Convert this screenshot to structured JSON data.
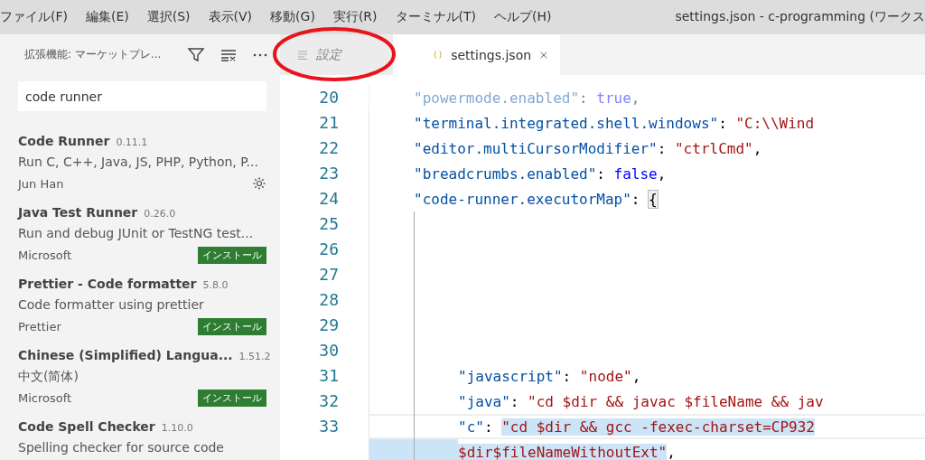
{
  "menu_bar": {
    "items": [
      "ファイル(F)",
      "編集(E)",
      "選択(S)",
      "表示(V)",
      "移動(G)",
      "実行(R)",
      "ターミナル(T)",
      "ヘルプ(H)"
    ],
    "title": "settings.json - c-programming (ワークス"
  },
  "sidebar": {
    "title": "拡張機能: マーケットプレ...",
    "search": {
      "value": "code runner"
    },
    "extensions": [
      {
        "name": "Code Runner",
        "version": "0.11.1",
        "description": "Run C, C++, Java, JS, PHP, Python, P...",
        "publisher": "Jun Han",
        "action": {
          "kind": "gear"
        }
      },
      {
        "name": "Java Test Runner",
        "version": "0.26.0",
        "description": "Run and debug JUnit or TestNG test...",
        "publisher": "Microsoft",
        "action": {
          "kind": "install",
          "label": "インストール"
        }
      },
      {
        "name": "Prettier - Code formatter",
        "version": "5.8.0",
        "description": "Code formatter using prettier",
        "publisher": "Prettier",
        "action": {
          "kind": "install",
          "label": "インストール"
        }
      },
      {
        "name": "Chinese (Simplified) Langua...",
        "version": "1.51.2",
        "description": "中文(简体)",
        "publisher": "Microsoft",
        "action": {
          "kind": "install",
          "label": "インストール"
        }
      },
      {
        "name": "Code Spell Checker",
        "version": "1.10.0",
        "description": "Spelling checker for source code"
      }
    ]
  },
  "tabs": [
    {
      "label": "設定",
      "kind": "settings",
      "selected": false
    },
    {
      "label": "settings.json",
      "kind": "json",
      "selected": true
    }
  ],
  "editor": {
    "lines": [
      {
        "number": "20",
        "faded": true,
        "nested": false,
        "current": false,
        "tokens": [
          {
            "text": "\"powermode.enabled\"",
            "kind": "key",
            "selected": false
          },
          {
            "text": ": ",
            "kind": "punct",
            "selected": false
          },
          {
            "text": "true",
            "kind": "bool",
            "selected": false
          },
          {
            "text": ",",
            "kind": "punct",
            "selected": false
          }
        ]
      },
      {
        "number": "21",
        "faded": false,
        "nested": false,
        "current": false,
        "tokens": [
          {
            "text": "\"terminal.integrated.shell.windows\"",
            "kind": "key",
            "selected": false
          },
          {
            "text": ": ",
            "kind": "punct",
            "selected": false
          },
          {
            "text": "\"C:\\\\Wind",
            "kind": "string",
            "selected": false
          }
        ]
      },
      {
        "number": "22",
        "faded": false,
        "nested": false,
        "current": false,
        "tokens": [
          {
            "text": "\"editor.multiCursorModifier\"",
            "kind": "key",
            "selected": false
          },
          {
            "text": ": ",
            "kind": "punct",
            "selected": false
          },
          {
            "text": "\"ctrlCmd\"",
            "kind": "string",
            "selected": false
          },
          {
            "text": ",",
            "kind": "punct",
            "selected": false
          }
        ]
      },
      {
        "number": "23",
        "faded": false,
        "nested": false,
        "current": false,
        "tokens": [
          {
            "text": "\"breadcrumbs.enabled\"",
            "kind": "key",
            "selected": false
          },
          {
            "text": ": ",
            "kind": "punct",
            "selected": false
          },
          {
            "text": "false",
            "kind": "bool",
            "selected": false
          },
          {
            "text": ",",
            "kind": "punct",
            "selected": false
          }
        ]
      },
      {
        "number": "24",
        "faded": false,
        "nested": false,
        "current": false,
        "tokens": [
          {
            "text": "\"code-runner.executorMap\"",
            "kind": "key",
            "selected": false
          },
          {
            "text": ": ",
            "kind": "punct",
            "selected": false
          },
          {
            "text": "{",
            "kind": "bracket",
            "selected": false
          }
        ]
      },
      {
        "number": "25",
        "faded": false,
        "nested": true,
        "current": false
      },
      {
        "number": "26",
        "faded": false,
        "nested": true,
        "current": false
      },
      {
        "number": "27",
        "faded": false,
        "nested": true,
        "current": false
      },
      {
        "number": "28",
        "faded": false,
        "nested": true,
        "current": false
      },
      {
        "number": "29",
        "faded": false,
        "nested": true,
        "current": false
      },
      {
        "number": "30",
        "faded": false,
        "nested": true,
        "current": false
      },
      {
        "number": "31",
        "faded": false,
        "nested": true,
        "current": false,
        "tokens": [
          {
            "text": "\"javascript\"",
            "kind": "key",
            "selected": false
          },
          {
            "text": ": ",
            "kind": "punct",
            "selected": false
          },
          {
            "text": "\"node\"",
            "kind": "string",
            "selected": false
          },
          {
            "text": ",",
            "kind": "punct",
            "selected": false
          }
        ]
      },
      {
        "number": "32",
        "faded": false,
        "nested": true,
        "current": false,
        "tokens": [
          {
            "text": "\"java\"",
            "kind": "key",
            "selected": false
          },
          {
            "text": ": ",
            "kind": "punct",
            "selected": false
          },
          {
            "text": "\"cd $dir && javac $fileName && jav",
            "kind": "string",
            "selected": false
          }
        ]
      },
      {
        "number": "33",
        "faded": false,
        "nested": true,
        "current": true,
        "tokens": [
          {
            "text": "\"c\"",
            "kind": "key",
            "selected": false
          },
          {
            "text": ": ",
            "kind": "punct",
            "selected": false
          },
          {
            "text": "\"cd $dir && gcc -fexec-charset=CP932",
            "kind": "string",
            "selected": true
          }
        ]
      },
      {
        "nested": true,
        "faded": false,
        "current": false,
        "tokens": [
          {
            "text": "$dir$fileNameWithoutExt\"",
            "kind": "string",
            "selected": true
          },
          {
            "text": ",",
            "kind": "punct",
            "selected": false
          }
        ]
      }
    ]
  }
}
